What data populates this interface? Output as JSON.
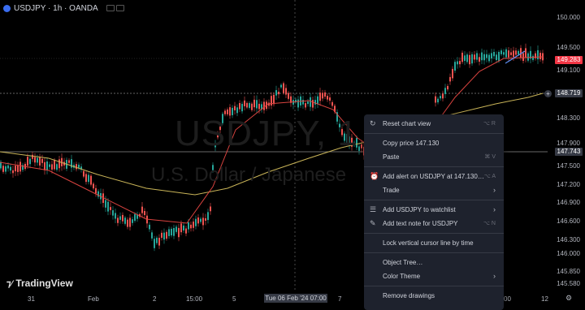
{
  "header": {
    "title": "USDJPY · 1h · OANDA"
  },
  "watermark": {
    "symbol": "USDJPY, 1",
    "description": "U.S. Dollar / Japanese"
  },
  "logo": {
    "text": "TradingView"
  },
  "price_axis": {
    "ticks": [
      "150.000",
      "149.500",
      "149.100",
      "148.700",
      "148.300",
      "147.900",
      "147.500",
      "147.200",
      "146.900",
      "146.600",
      "146.300",
      "146.000",
      "145.850",
      "145.580"
    ],
    "tags": [
      {
        "text": "149.283",
        "color": "#f23645"
      },
      {
        "text": "148.719",
        "color": "#363a45"
      },
      {
        "text": "147.743",
        "color": "#363a45"
      }
    ]
  },
  "time_axis": {
    "ticks": [
      "31",
      "Feb",
      "2",
      "15:00",
      "5",
      "7",
      "00",
      "12"
    ],
    "crosshair_label": "Tue 06 Feb '24   07:00"
  },
  "context_menu": {
    "items": [
      {
        "label": "Reset chart view",
        "icon": "reset-icon",
        "shortcut": "⌥ R",
        "arrow": false
      },
      {
        "sep": true
      },
      {
        "label": "Copy price 147.130",
        "icon": "",
        "shortcut": "",
        "arrow": false
      },
      {
        "label": "Paste",
        "icon": "",
        "shortcut": "⌘ V",
        "arrow": false
      },
      {
        "sep": true
      },
      {
        "label": "Add alert on USDJPY at 147.130…",
        "icon": "alert-clock-icon",
        "shortcut": "⌥ A",
        "arrow": false
      },
      {
        "label": "Trade",
        "icon": "",
        "shortcut": "",
        "arrow": true
      },
      {
        "sep": true
      },
      {
        "label": "Add USDJPY to watchlist",
        "icon": "watchlist-icon",
        "shortcut": "",
        "arrow": true
      },
      {
        "label": "Add text note for USDJPY",
        "icon": "note-icon",
        "shortcut": "⌥ N",
        "arrow": false
      },
      {
        "sep": true
      },
      {
        "label": "Lock vertical cursor line by time",
        "icon": "",
        "shortcut": "",
        "arrow": false
      },
      {
        "sep": true
      },
      {
        "label": "Object Tree…",
        "icon": "",
        "shortcut": "",
        "arrow": false
      },
      {
        "label": "Color Theme",
        "icon": "",
        "shortcut": "",
        "arrow": true
      },
      {
        "sep": true
      },
      {
        "label": "Remove drawings",
        "icon": "",
        "shortcut": "",
        "arrow": false
      }
    ]
  },
  "colors": {
    "up": "#26a69a",
    "down": "#ef5350",
    "ma_fast": "#ef5350",
    "ma_slow": "#c9b458",
    "line_blue": "#5b8def"
  }
}
